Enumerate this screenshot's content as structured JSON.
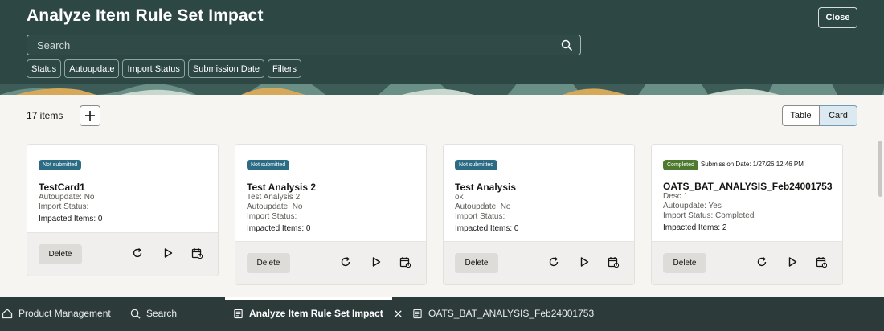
{
  "header": {
    "title": "Analyze Item Rule Set Impact",
    "close_label": "Close",
    "search_placeholder": "Search",
    "filters": [
      "Status",
      "Autoupdate",
      "Import Status",
      "Submission Date",
      "Filters"
    ]
  },
  "toolbar": {
    "count_text": "17 items",
    "view_table": "Table",
    "view_card": "Card"
  },
  "cards": [
    {
      "status": "Not submitted",
      "name": "TestCard1",
      "desc": "",
      "autoupdate": "Autoupdate: No",
      "import_status": "Import Status:",
      "impacted": "Impacted Items: 0",
      "delete_label": "Delete"
    },
    {
      "status": "Not submitted",
      "name": "Test Analysis 2",
      "desc": "Test Analysis 2",
      "autoupdate": "Autoupdate: No",
      "import_status": "Import Status:",
      "impacted": "Impacted Items: 0",
      "delete_label": "Delete"
    },
    {
      "status": "Not submitted",
      "name": "Test Analysis",
      "desc": "ok",
      "autoupdate": "Autoupdate: No",
      "import_status": "Import Status:",
      "impacted": "Impacted Items: 0",
      "delete_label": "Delete"
    },
    {
      "status": "Completed",
      "submission_date": "Submission Date: 1/27/26 12:46 PM",
      "name": "OATS_BAT_ANALYSIS_Feb24001753",
      "desc": "Desc 1",
      "autoupdate": "Autoupdate: Yes",
      "import_status": "Import Status: Completed",
      "impacted": "Impacted Items: 2",
      "delete_label": "Delete"
    }
  ],
  "navbar": {
    "product_management": "Product Management",
    "search": "Search",
    "active_tab": "Analyze Item Rule Set Impact",
    "other_tab": "OATS_BAT_ANALYSIS_Feb24001753"
  },
  "colors": {
    "header_bg": "#2c4744",
    "navbar_bg": "#2c3b39",
    "badge_not_submitted": "#2b6b84",
    "badge_completed": "#4d7a2e"
  }
}
